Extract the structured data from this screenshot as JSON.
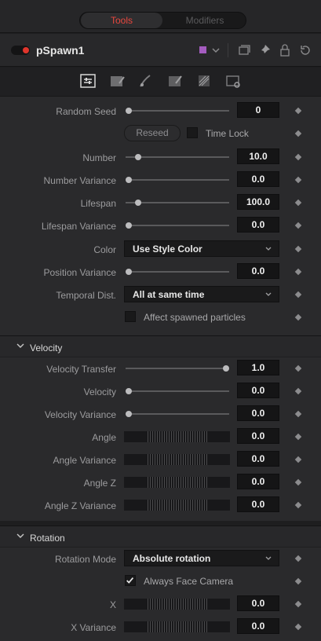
{
  "top_tabs": {
    "tools": "Tools",
    "modifiers": "Modifiers"
  },
  "header": {
    "title": "pSpawn1",
    "color_swatch": "#a45cbf",
    "icons": [
      "chevron-down-icon",
      "window-icon",
      "pin-icon",
      "lock-icon",
      "reset-icon"
    ]
  },
  "control_tabs": [
    "controls-icon",
    "style-icon",
    "region-icon",
    "conditions-icon",
    "sets-icon",
    "settings-icon"
  ],
  "controls": {
    "random_seed": {
      "label": "Random Seed",
      "value": "0"
    },
    "reseed": "Reseed",
    "time_lock": "Time Lock",
    "number": {
      "label": "Number",
      "value": "10.0"
    },
    "number_variance": {
      "label": "Number Variance",
      "value": "0.0"
    },
    "lifespan": {
      "label": "Lifespan",
      "value": "100.0"
    },
    "lifespan_variance": {
      "label": "Lifespan Variance",
      "value": "0.0"
    },
    "color": {
      "label": "Color",
      "value": "Use Style Color"
    },
    "position_variance": {
      "label": "Position Variance",
      "value": "0.0"
    },
    "temporal_dist": {
      "label": "Temporal Dist.",
      "value": "All at same time"
    },
    "affect_spawned": "Affect spawned particles"
  },
  "velocity": {
    "title": "Velocity",
    "velocity_transfer": {
      "label": "Velocity Transfer",
      "value": "1.0"
    },
    "velocity": {
      "label": "Velocity",
      "value": "0.0"
    },
    "velocity_variance": {
      "label": "Velocity Variance",
      "value": "0.0"
    },
    "angle": {
      "label": "Angle",
      "value": "0.0"
    },
    "angle_variance": {
      "label": "Angle Variance",
      "value": "0.0"
    },
    "angle_z": {
      "label": "Angle Z",
      "value": "0.0"
    },
    "angle_z_variance": {
      "label": "Angle Z Variance",
      "value": "0.0"
    }
  },
  "rotation": {
    "title": "Rotation",
    "rotation_mode": {
      "label": "Rotation Mode",
      "value": "Absolute rotation"
    },
    "always_face_camera": "Always Face Camera",
    "x": {
      "label": "X",
      "value": "0.0"
    },
    "x_variance": {
      "label": "X Variance",
      "value": "0.0"
    }
  },
  "accent_color": "#e0352c"
}
